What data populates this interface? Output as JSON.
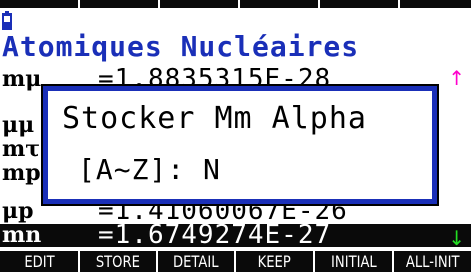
{
  "app": {
    "title": "Atomiques Nucléaires",
    "battery_icon": "battery-icon"
  },
  "list": {
    "rows": [
      {
        "symbol": "mμ",
        "value": "=1.8835315E-28"
      },
      {
        "symbol": "μμ",
        "value": ""
      },
      {
        "symbol": "mτ",
        "value": ""
      },
      {
        "symbol": "mp",
        "value": ""
      },
      {
        "symbol": "μp",
        "value": "=1.41060067E-26"
      },
      {
        "symbol": "mn",
        "value": "=1.6749274E-27",
        "selected": true
      }
    ],
    "scroll_up_icon": "arrow-up-icon",
    "scroll_down_icon": "arrow-down-icon"
  },
  "dialog": {
    "title": "Stocker Mm Alpha",
    "prompt": "[A~Z]: N"
  },
  "function_keys": [
    "EDIT",
    "STORE",
    "DETAIL",
    "KEEP",
    "INITIAL",
    "ALL-INIT"
  ],
  "colors": {
    "accent": "#1a2fb8",
    "scroll_up": "#ff00cc",
    "scroll_down": "#22dd22",
    "selection": "#0a0a0a"
  }
}
